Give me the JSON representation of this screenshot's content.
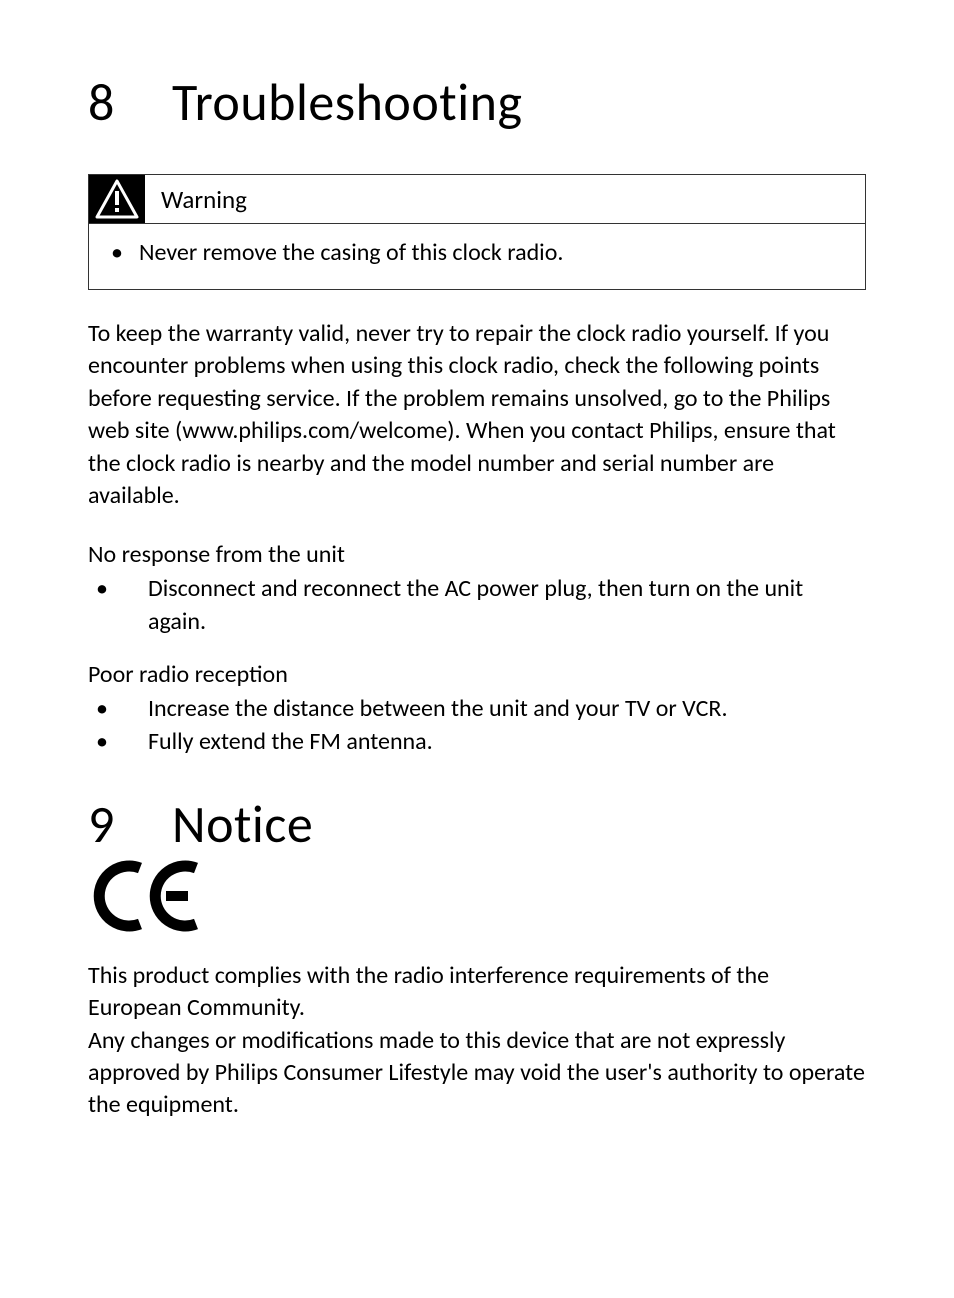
{
  "section8": {
    "number": "8",
    "title": "Troubleshooting",
    "warning": {
      "label": "Warning",
      "item": "Never remove the casing of this clock radio."
    },
    "intro": "To keep the warranty valid, never try to repair the clock radio yourself. If you encounter problems when using this clock radio, check the following points before requesting service. If the problem remains unsolved, go to the Philips web site (www.philips.com/welcome). When you contact Philips, ensure that the clock radio is nearby and the model number and serial number are available.",
    "issues": [
      {
        "title": "No response from the unit",
        "items": [
          "Disconnect and reconnect the AC power plug, then turn on the unit again."
        ]
      },
      {
        "title": "Poor radio reception",
        "items": [
          "Increase the distance between the unit and your TV or VCR.",
          "Fully extend the FM antenna."
        ]
      }
    ]
  },
  "section9": {
    "number": "9",
    "title": "Notice",
    "body1": "This product complies with the radio interference requirements of the European Community.",
    "body2": "Any changes or modifications made to this device that are not expressly approved by Philips Consumer Lifestyle may void the user's authority to operate the equipment."
  }
}
